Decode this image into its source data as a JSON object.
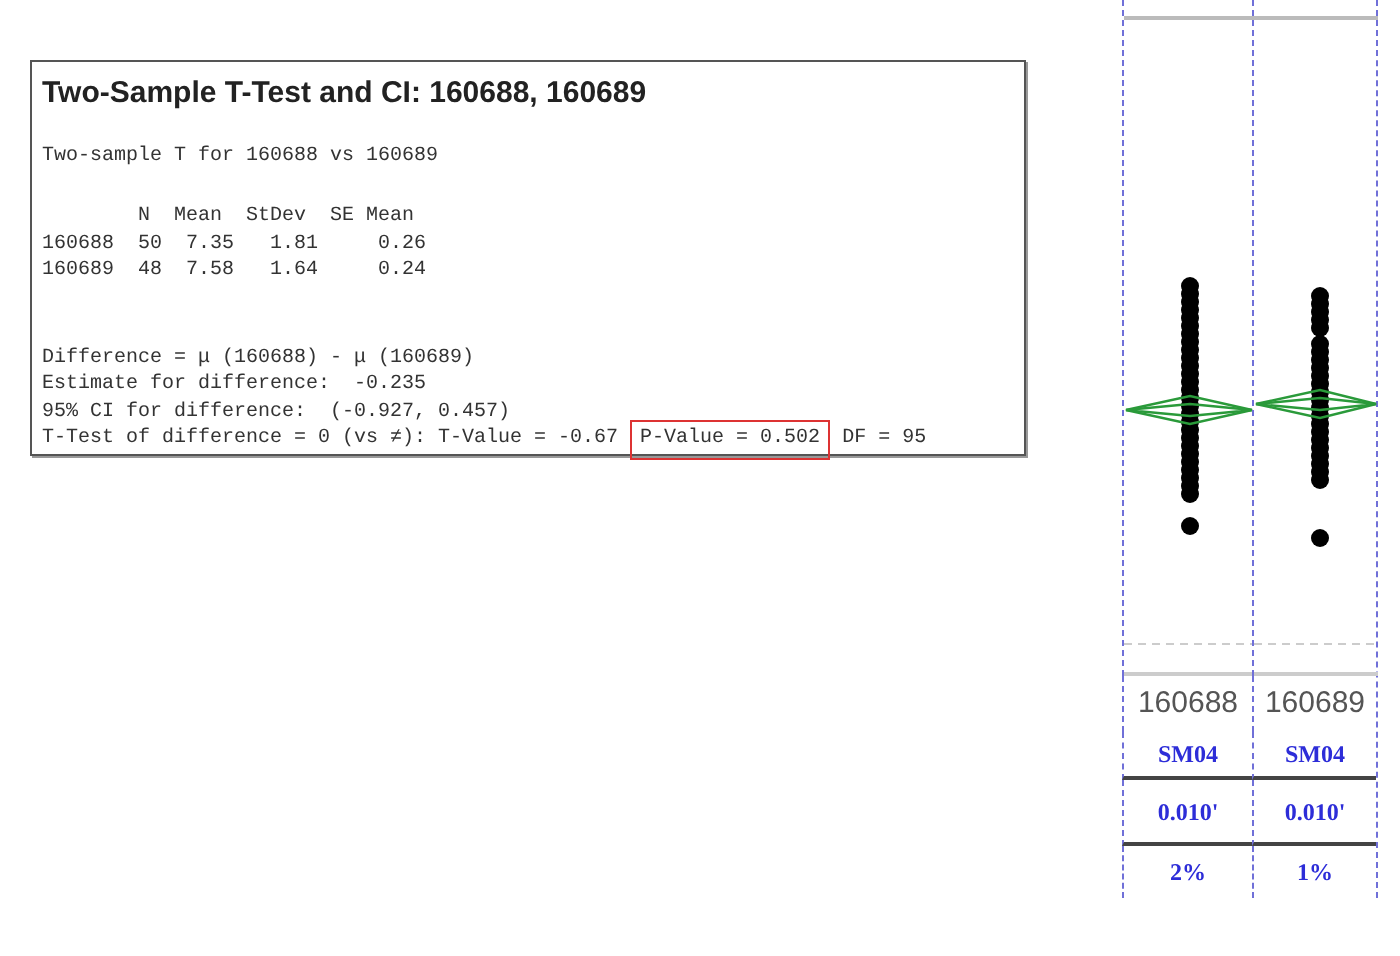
{
  "session_output": {
    "title": "Two-Sample T-Test and CI: 160688, 160689",
    "blocks": [
      [
        {
          "parts": [
            {
              "text": "Two-sample T for 160688 vs 160689",
              "boxed": false
            }
          ]
        }
      ],
      [
        {
          "parts": [
            {
              "text": "        N  Mean  StDev  SE Mean",
              "boxed": false
            }
          ]
        },
        {
          "parts": [
            {
              "text": "160688  50  7.35   1.81     0.26",
              "boxed": false
            }
          ]
        },
        {
          "parts": [
            {
              "text": "160689  48  7.58   1.64     0.24",
              "boxed": false
            }
          ]
        }
      ],
      [
        {
          "parts": [
            {
              "text": "Difference = μ (160688) - μ (160689)",
              "boxed": false
            }
          ]
        },
        {
          "parts": [
            {
              "text": "Estimate for difference:  -0.235",
              "boxed": false
            }
          ]
        },
        {
          "parts": [
            {
              "text": "95% CI for difference:  (-0.927, 0.457)",
              "boxed": false
            }
          ]
        },
        {
          "parts": [
            {
              "text": "T-Test of difference = 0 (vs ≠): T-Value = -0.67",
              "boxed": false
            },
            {
              "text": "P-Value = 0.502",
              "boxed": true
            },
            {
              "text": "DF = 95",
              "boxed": false
            }
          ]
        }
      ]
    ]
  },
  "plot_columns": [
    {
      "label": "160688",
      "group": "SM04",
      "value": "0.010'",
      "percent": "2%"
    },
    {
      "label": "160689",
      "group": "SM04",
      "value": "0.010'",
      "percent": "1%"
    }
  ]
}
